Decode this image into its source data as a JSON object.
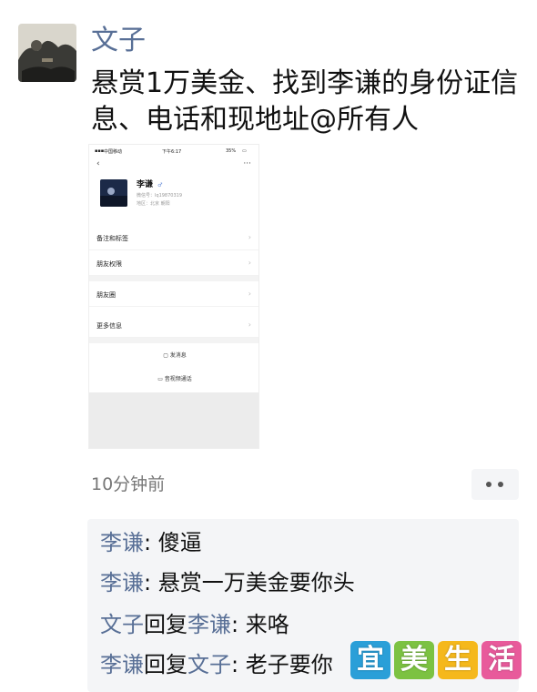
{
  "post": {
    "author": "文子",
    "text": "悬赏1万美金、找到李谦的身份证信息、电话和现地址@所有人",
    "time_ago": "10分钟前"
  },
  "screenshot": {
    "status_bar": {
      "carrier": "中国移动",
      "time": "下午6:17",
      "battery": "35%"
    },
    "nav": {
      "back": "‹",
      "more": "···"
    },
    "profile": {
      "name": "李谦",
      "gender_icon": "male-icon",
      "wechat_id": "微信号：lq19870319",
      "region": "地区：北京 朝阳"
    },
    "rows": [
      {
        "label": "备注和标签"
      },
      {
        "label": "朋友权限"
      },
      {
        "label": "朋友圈"
      },
      {
        "label": "更多信息"
      }
    ],
    "actions": {
      "message": "发消息",
      "call": "音视频通话"
    }
  },
  "comments": [
    {
      "name": "李谦",
      "sep": ": ",
      "text": "傻逼"
    },
    {
      "name": "李谦",
      "sep": ": ",
      "text": "悬赏一万美金要你头"
    },
    {
      "name": "文子",
      "reply": "回复",
      "target": "李谦",
      "sep": ": ",
      "text": "来咯"
    },
    {
      "name": "李谦",
      "reply": "回复",
      "target": "文子",
      "sep": ": ",
      "text": "老子要你"
    }
  ],
  "watermark": {
    "chars": [
      "宜",
      "美",
      "生",
      "活"
    ],
    "colors": [
      "#2a9fd8",
      "#7cc242",
      "#f5b81c",
      "#e85a9b"
    ]
  },
  "colors": {
    "name_link": "#586f96",
    "comment_bg": "#f4f5f7"
  }
}
